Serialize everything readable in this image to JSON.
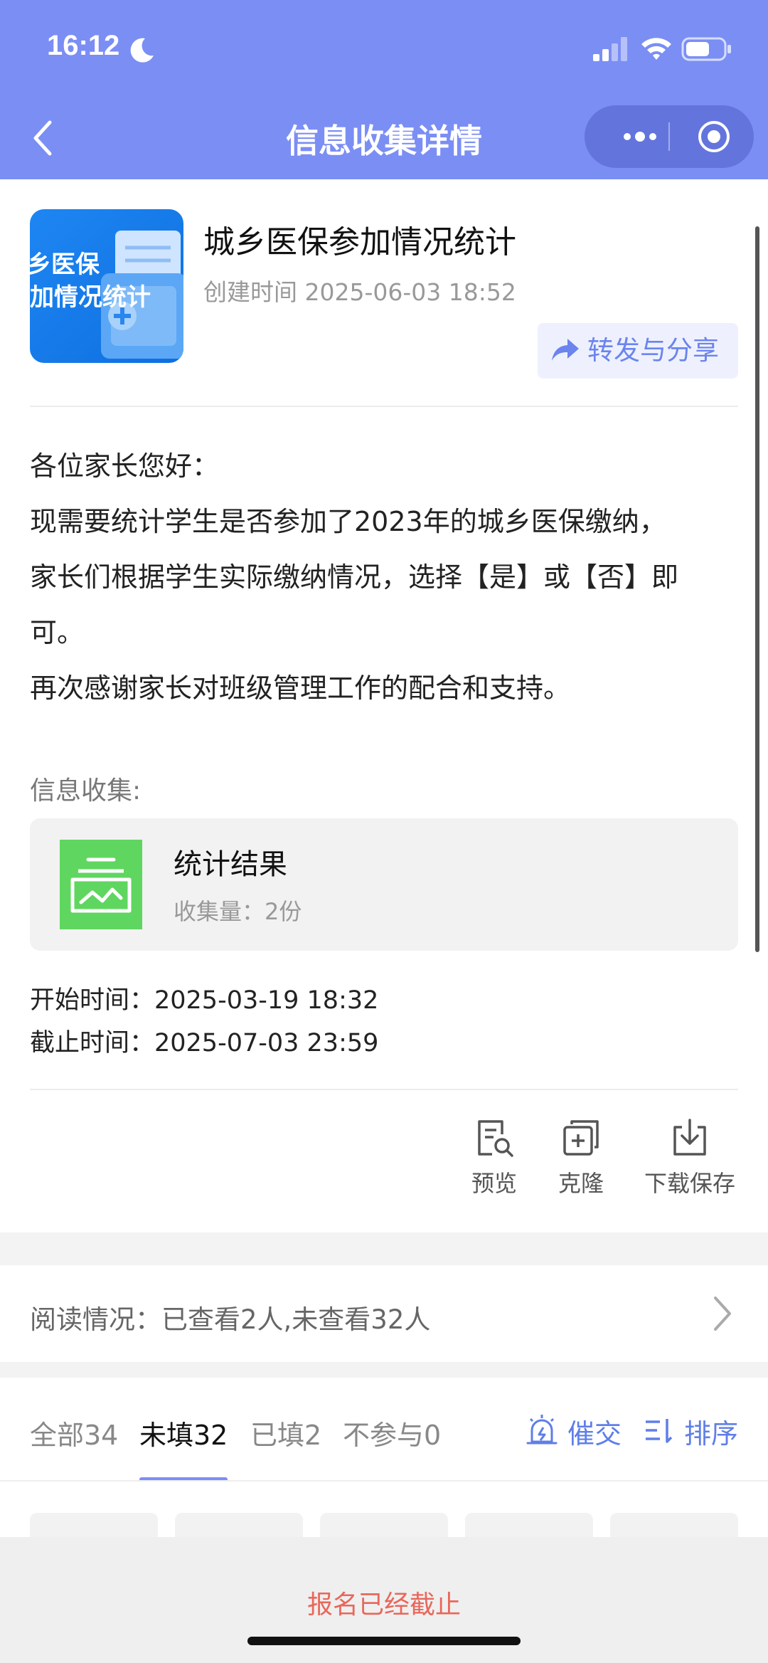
{
  "status": {
    "time": "16:12"
  },
  "nav": {
    "title": "信息收集详情"
  },
  "doc": {
    "cover_line1": "乡医保",
    "cover_line2": "加情况统计",
    "title": "城乡医保参加情况统计",
    "created": "创建时间 2025-06-03 18:52",
    "share_label": "转发与分享"
  },
  "body": {
    "lines": [
      "各位家长您好：",
      "现需要统计学生是否参加了2023年的城乡医保缴纳，",
      "家长们根据学生实际缴纳情况，选择【是】或【否】即",
      "可。",
      "再次感谢家长对班级管理工作的配合和支持。"
    ]
  },
  "collect": {
    "label": "信息收集:",
    "card_title": "统计结果",
    "card_sub": "收集量：2份"
  },
  "times": {
    "start": "开始时间：2025-03-19 18:32",
    "end": "截止时间：2025-07-03 23:59"
  },
  "tools": {
    "preview": "预览",
    "clone": "克隆",
    "download": "下载保存"
  },
  "reading": {
    "text": "阅读情况：已查看2人,未查看32人"
  },
  "tabs": {
    "all": "全部34",
    "unfilled": "未填32",
    "filled": "已填2",
    "absent": "不参与0"
  },
  "actions": {
    "remind": "催交",
    "sort": "排序"
  },
  "footer": {
    "text": "报名已经截止"
  },
  "colors": {
    "header": "#7b8ef4",
    "accent": "#5f7ee8",
    "deadline": "#e8675b",
    "stat_icon": "#5fd65f"
  }
}
